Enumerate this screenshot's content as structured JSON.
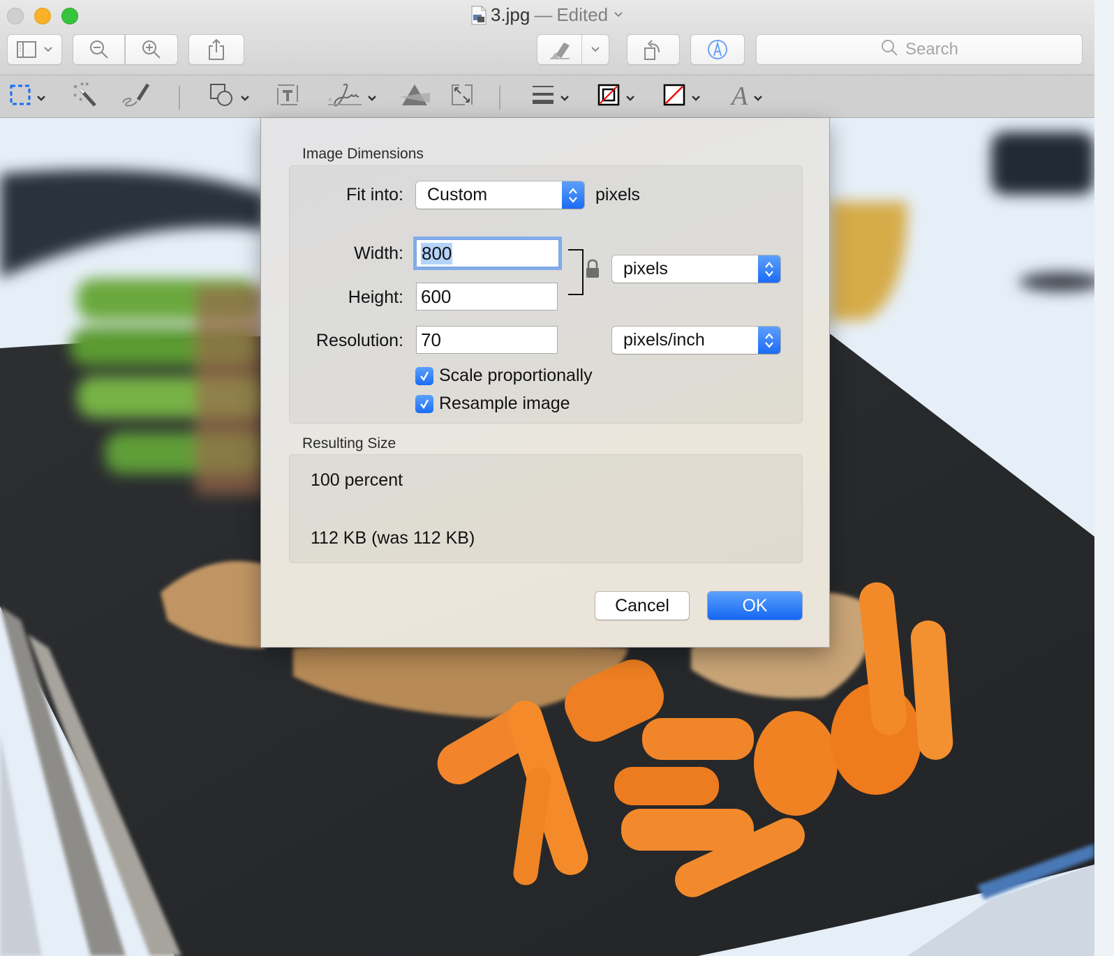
{
  "window": {
    "title": "3.jpg",
    "title_separator": "—",
    "title_status": "Edited",
    "traffic_lights": [
      "close",
      "minimize",
      "zoom"
    ]
  },
  "toolbar": {
    "buttons": [
      {
        "name": "sidebar-view-button",
        "icon": "sidebar-icon"
      },
      {
        "name": "zoom-out-button",
        "icon": "zoom-out-icon"
      },
      {
        "name": "zoom-in-button",
        "icon": "zoom-in-icon"
      },
      {
        "name": "share-button",
        "icon": "share-icon"
      },
      {
        "name": "highlight-button",
        "icon": "highlighter-icon"
      },
      {
        "name": "rotate-button",
        "icon": "rotate-left-icon"
      },
      {
        "name": "markup-button",
        "icon": "markup-pen-icon"
      }
    ],
    "search_placeholder": "Search"
  },
  "markup_toolbar": {
    "tools": [
      "rectangular-selection",
      "instant-alpha",
      "sketch",
      "shapes",
      "text",
      "sign",
      "adjust-color",
      "adjust-size",
      "shape-style",
      "border-color",
      "fill-color",
      "text-style"
    ]
  },
  "dialog": {
    "image_dimensions_label": "Image Dimensions",
    "fit_into_label": "Fit into:",
    "fit_into_value": "Custom",
    "fit_into_unit": "pixels",
    "width_label": "Width:",
    "width_value": "800",
    "height_label": "Height:",
    "height_value": "600",
    "size_unit_value": "pixels",
    "resolution_label": "Resolution:",
    "resolution_value": "70",
    "resolution_unit_value": "pixels/inch",
    "scale_proportionally_label": "Scale proportionally",
    "scale_proportionally_checked": true,
    "resample_image_label": "Resample image",
    "resample_image_checked": true,
    "resulting_size_label": "Resulting Size",
    "resulting_percent": "100 percent",
    "resulting_filesize": "112 KB (was 112 KB)",
    "cancel_label": "Cancel",
    "ok_label": "OK"
  },
  "colors": {
    "accent_blue": "#1c6cf5",
    "focus_ring": "#82abe8",
    "selection_highlight": "#b3d3fb",
    "traffic_min": "#f8b128",
    "traffic_max": "#37c43d"
  }
}
